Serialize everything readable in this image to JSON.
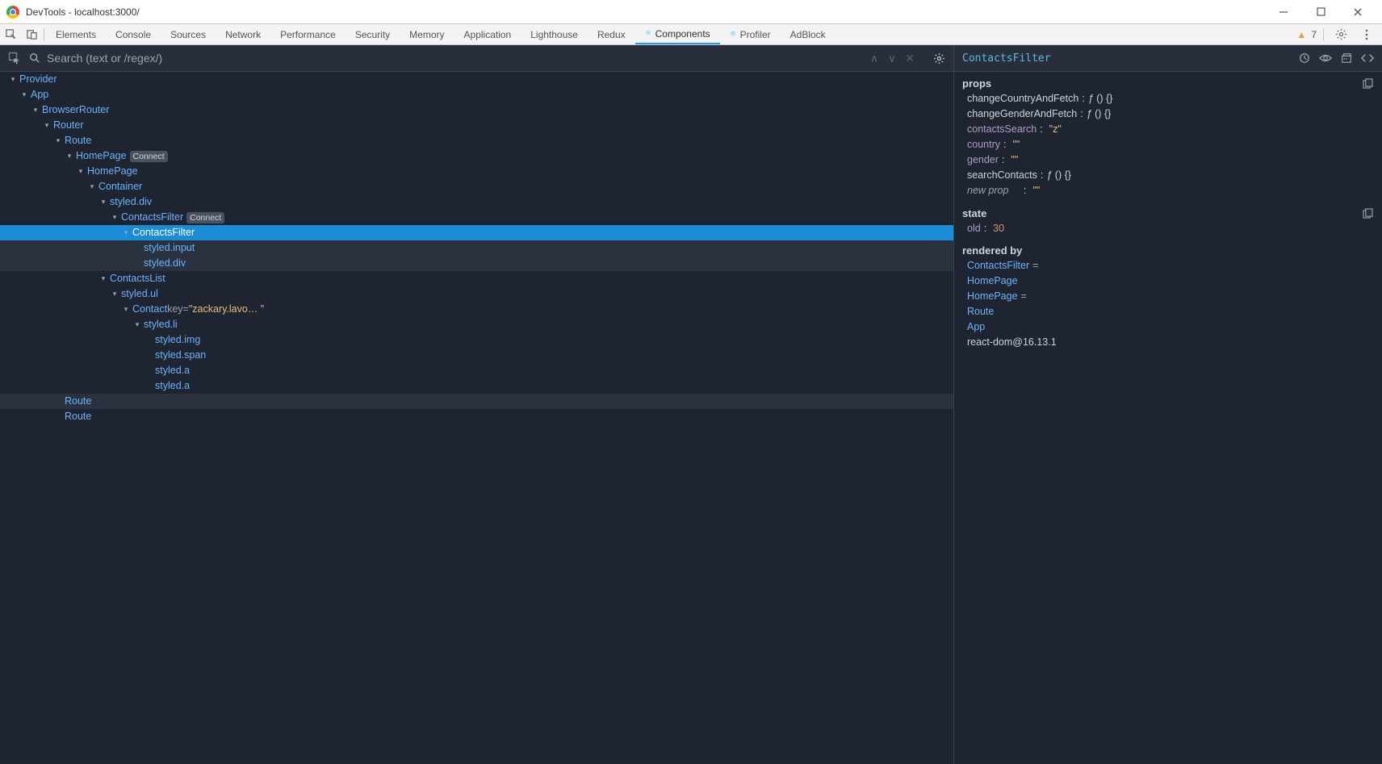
{
  "window": {
    "title": "DevTools - localhost:3000/"
  },
  "tabs": {
    "list": [
      "Elements",
      "Console",
      "Sources",
      "Network",
      "Performance",
      "Security",
      "Memory",
      "Application",
      "Lighthouse",
      "Redux",
      "Components",
      "Profiler",
      "AdBlock"
    ],
    "active_index": 10,
    "warning_count": "7"
  },
  "search": {
    "placeholder": "Search (text or /regex/)"
  },
  "tree": [
    {
      "depth": 0,
      "caret": true,
      "label": "Provider"
    },
    {
      "depth": 1,
      "caret": true,
      "label": "App"
    },
    {
      "depth": 2,
      "caret": true,
      "label": "BrowserRouter"
    },
    {
      "depth": 3,
      "caret": true,
      "label": "Router"
    },
    {
      "depth": 4,
      "caret": true,
      "label": "Route"
    },
    {
      "depth": 5,
      "caret": true,
      "label": "HomePage",
      "badge": "Connect"
    },
    {
      "depth": 6,
      "caret": true,
      "label": "HomePage"
    },
    {
      "depth": 7,
      "caret": true,
      "label": "Container"
    },
    {
      "depth": 8,
      "caret": true,
      "label": "styled.div"
    },
    {
      "depth": 9,
      "caret": true,
      "label": "ContactsFilter",
      "badge": "Connect"
    },
    {
      "depth": 10,
      "caret": true,
      "label": "ContactsFilter",
      "selected": true
    },
    {
      "depth": 11,
      "caret": false,
      "label": "styled.input",
      "shade": true
    },
    {
      "depth": 11,
      "caret": false,
      "label": "styled.div",
      "shade": true
    },
    {
      "depth": 8,
      "caret": true,
      "label": "ContactsList"
    },
    {
      "depth": 9,
      "caret": true,
      "label": "styled.ul"
    },
    {
      "depth": 10,
      "caret": true,
      "label": "Contact",
      "keyLabel": "key",
      "keyVal": "\"zackary.lavo… \""
    },
    {
      "depth": 11,
      "caret": true,
      "label": "styled.li"
    },
    {
      "depth": 12,
      "caret": false,
      "label": "styled.img"
    },
    {
      "depth": 12,
      "caret": false,
      "label": "styled.span"
    },
    {
      "depth": 12,
      "caret": false,
      "label": "styled.a"
    },
    {
      "depth": 12,
      "caret": false,
      "label": "styled.a"
    },
    {
      "depth": 4,
      "caret": false,
      "label": "Route",
      "shade": true
    },
    {
      "depth": 4,
      "caret": false,
      "label": "Route"
    }
  ],
  "details": {
    "header": "ContactsFilter",
    "props_title": "props",
    "props": [
      {
        "name": "changeCountryAndFetch",
        "kind": "fn"
      },
      {
        "name": "changeGenderAndFetch",
        "kind": "fn"
      },
      {
        "name": "contactsSearch",
        "kind": "str",
        "val": "\"z\""
      },
      {
        "name": "country",
        "kind": "str",
        "val": "\"\""
      },
      {
        "name": "gender",
        "kind": "str",
        "val": "\"\""
      },
      {
        "name": "searchContacts",
        "kind": "fn"
      }
    ],
    "new_prop_label": "new prop",
    "new_prop_val": "\"\"",
    "state_title": "state",
    "state": [
      {
        "name": "old",
        "val": "30"
      }
    ],
    "rendered_title": "rendered by",
    "rendered_by": [
      {
        "label": "ContactsFilter",
        "suffix": "="
      },
      {
        "label": "HomePage"
      },
      {
        "label": "HomePage",
        "suffix": "="
      },
      {
        "label": "Route"
      },
      {
        "label": "App"
      }
    ],
    "react_ver": "react-dom@16.13.1"
  }
}
